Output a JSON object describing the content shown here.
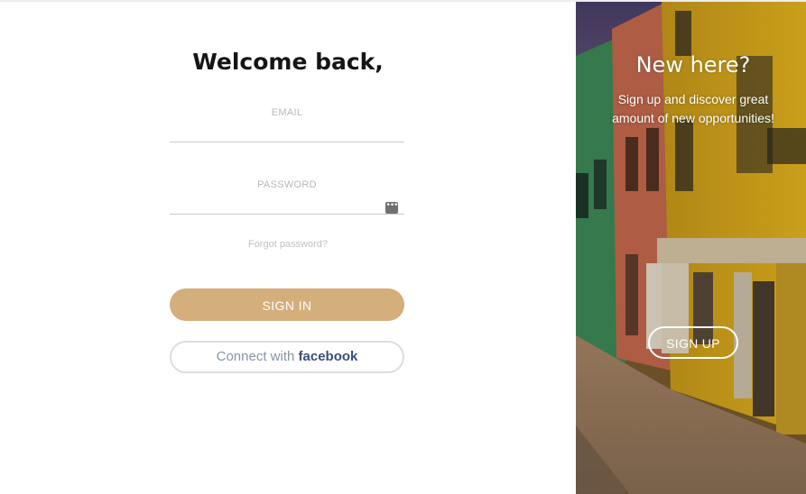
{
  "login": {
    "title": "Welcome back,",
    "email_label": "EMAIL",
    "email_value": "",
    "password_label": "PASSWORD",
    "password_value": "",
    "password_icon": "password-manager-icon",
    "forgot_label": "Forgot password?",
    "signin_label": "SIGN IN",
    "facebook_prefix": "Connect with",
    "facebook_brand": "facebook"
  },
  "promo": {
    "title": "New here?",
    "text": "Sign up and discover great amount of new opportunities!",
    "signup_label": "SIGN UP",
    "background": "street-photo"
  },
  "colors": {
    "accent": "#d4ae7b",
    "facebook_brand": "#3a4f78",
    "label": "#b8b8b8"
  }
}
